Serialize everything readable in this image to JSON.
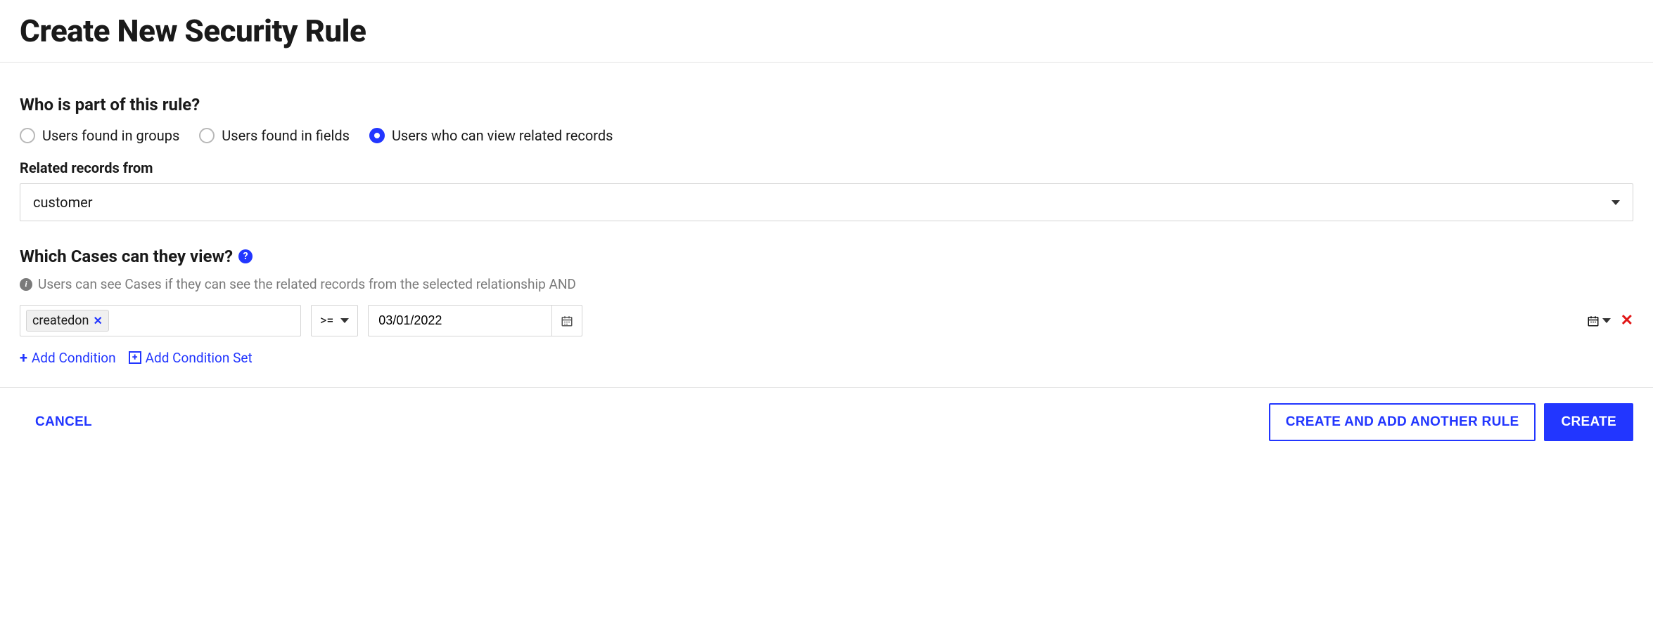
{
  "page_title": "Create New Security Rule",
  "section_who": {
    "heading": "Who is part of this rule?",
    "options": {
      "groups": "Users found in groups",
      "fields": "Users found in fields",
      "related": "Users who can view related records"
    },
    "related_from_label": "Related records from",
    "related_from_value": "customer"
  },
  "section_which": {
    "heading": "Which Cases can they view?",
    "info": "Users can see Cases if they can see the related records from the selected relationship AND",
    "condition": {
      "field": "createdon",
      "operator": ">=",
      "value": "03/01/2022"
    },
    "add_condition": "Add Condition",
    "add_condition_set": "Add Condition Set"
  },
  "footer": {
    "cancel": "CANCEL",
    "create_another": "CREATE AND ADD ANOTHER RULE",
    "create": "CREATE"
  }
}
